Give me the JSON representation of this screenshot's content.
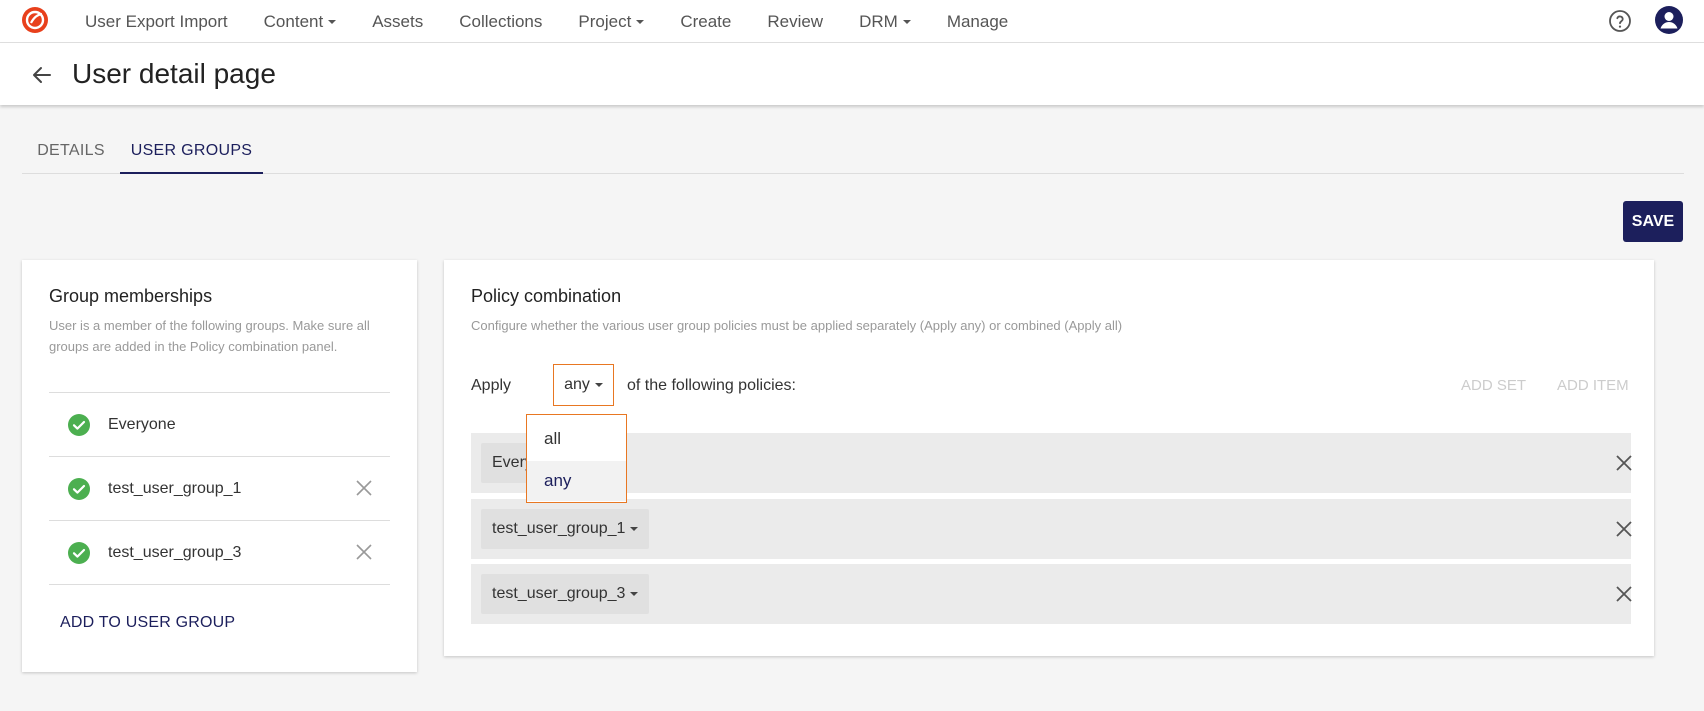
{
  "nav": {
    "items": [
      {
        "label": "User Export Import",
        "has_caret": false
      },
      {
        "label": "Content",
        "has_caret": true
      },
      {
        "label": "Assets",
        "has_caret": false
      },
      {
        "label": "Collections",
        "has_caret": false
      },
      {
        "label": "Project",
        "has_caret": true
      },
      {
        "label": "Create",
        "has_caret": false
      },
      {
        "label": "Review",
        "has_caret": false
      },
      {
        "label": "DRM",
        "has_caret": true
      },
      {
        "label": "Manage",
        "has_caret": false
      }
    ],
    "icons": {
      "logo": "app-logo-icon",
      "help": "help-circle-icon",
      "user": "user-avatar-icon"
    },
    "accent_color": "#e8401c"
  },
  "header": {
    "title": "User detail page",
    "back_icon": "arrow-left-icon"
  },
  "tabs": [
    {
      "label": "DETAILS",
      "active": false
    },
    {
      "label": "USER GROUPS",
      "active": true
    }
  ],
  "actions": {
    "save_label": "SAVE"
  },
  "group_memberships": {
    "title": "Group memberships",
    "description": "User is a member of the following groups. Make sure all groups are added in the Policy combination panel.",
    "groups": [
      {
        "name": "Everyone",
        "removable": false
      },
      {
        "name": "test_user_group_1",
        "removable": true
      },
      {
        "name": "test_user_group_3",
        "removable": true
      }
    ],
    "add_label": "ADD TO USER GROUP"
  },
  "policy_combination": {
    "title": "Policy combination",
    "description": "Configure whether the various user group policies must be applied separately (Apply any) or combined (Apply all)",
    "apply_label": "Apply",
    "apply_value": "any",
    "apply_suffix": "of the following policies:",
    "add_set_label": "ADD SET",
    "add_item_label": "ADD ITEM",
    "policies": [
      {
        "name": "Everyone"
      },
      {
        "name": "test_user_group_1"
      },
      {
        "name": "test_user_group_3"
      }
    ],
    "dropdown": {
      "options": [
        "all",
        "any"
      ],
      "selected": "any"
    }
  },
  "colors": {
    "primary": "#1c1f5c",
    "focus_border": "#e87722",
    "success": "#4caf50"
  }
}
